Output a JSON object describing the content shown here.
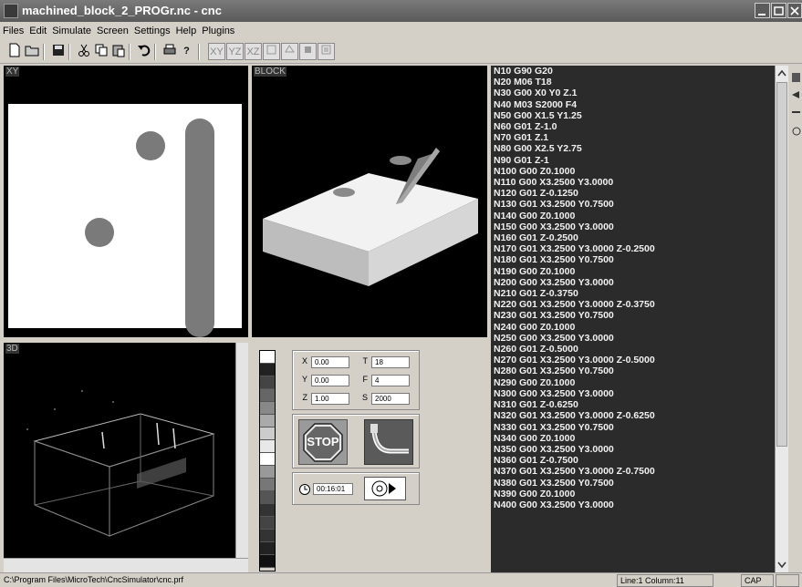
{
  "window": {
    "title": "machined_block_2_PROGr.nc - cnc"
  },
  "menu": [
    "Files",
    "Edit",
    "Simulate",
    "Screen",
    "Settings",
    "Help",
    "Plugins"
  ],
  "toolbar": {
    "view_buttons": [
      "XY",
      "YZ",
      "XZ"
    ]
  },
  "panes": {
    "xy_label": "XY",
    "block_label": "BLOCK",
    "three_d_label": "3D"
  },
  "position": {
    "x_label": "X",
    "x_value": "0.00",
    "y_label": "Y",
    "y_value": "0.00",
    "z_label": "Z",
    "z_value": "1.00",
    "t_label": "T",
    "t_value": "18",
    "f_label": "F",
    "f_value": "4",
    "s_label": "S",
    "s_value": "2000"
  },
  "controls": {
    "stop_label": "STOP",
    "timer_value": "00:16:01"
  },
  "colors": {
    "code_bg": "#2b2b2b",
    "code_text": "#f2f2f2",
    "part_gray": "#7a7a7a"
  },
  "program_lines": [
    "N10 G90 G20",
    "N20 M06 T18",
    "N30 G00 X0 Y0 Z.1",
    "N40 M03 S2000 F4",
    "N50 G00 X1.5 Y1.25",
    "N60 G01 Z-1.0",
    "N70 G01 Z.1",
    "N80 G00 X2.5 Y2.75",
    "N90 G01 Z-1",
    "N100 G00 Z0.1000",
    "N110 G00 X3.2500 Y3.0000",
    "N120 G01 Z-0.1250",
    "N130 G01 X3.2500 Y0.7500",
    "N140 G00 Z0.1000",
    "N150 G00 X3.2500 Y3.0000",
    "N160 G01 Z-0.2500",
    "N170 G01 X3.2500 Y3.0000 Z-0.2500",
    "N180 G01 X3.2500 Y0.7500",
    "N190 G00 Z0.1000",
    "N200 G00 X3.2500 Y3.0000",
    "N210 G01 Z-0.3750",
    "N220 G01 X3.2500 Y3.0000 Z-0.3750",
    "N230 G01 X3.2500 Y0.7500",
    "N240 G00 Z0.1000",
    "N250 G00 X3.2500 Y3.0000",
    "N260 G01 Z-0.5000",
    "N270 G01 X3.2500 Y3.0000 Z-0.5000",
    "N280 G01 X3.2500 Y0.7500",
    "N290 G00 Z0.1000",
    "N300 G00 X3.2500 Y3.0000",
    "N310 G01 Z-0.6250",
    "N320 G01 X3.2500 Y3.0000 Z-0.6250",
    "N330 G01 X3.2500 Y0.7500",
    "N340 G00 Z0.1000",
    "N350 G00 X3.2500 Y3.0000",
    "N360 G01 Z-0.7500",
    "N370 G01 X3.2500 Y3.0000 Z-0.7500",
    "N380 G01 X3.2500 Y0.7500",
    "N390 G00 Z0.1000",
    "N400 G00 X3.2500 Y3.0000"
  ],
  "status": {
    "path": "C:\\Program Files\\MicroTech\\CncSimulator\\cnc.prf",
    "cursor": "Line:1 Column:11",
    "caps": "CAP"
  }
}
